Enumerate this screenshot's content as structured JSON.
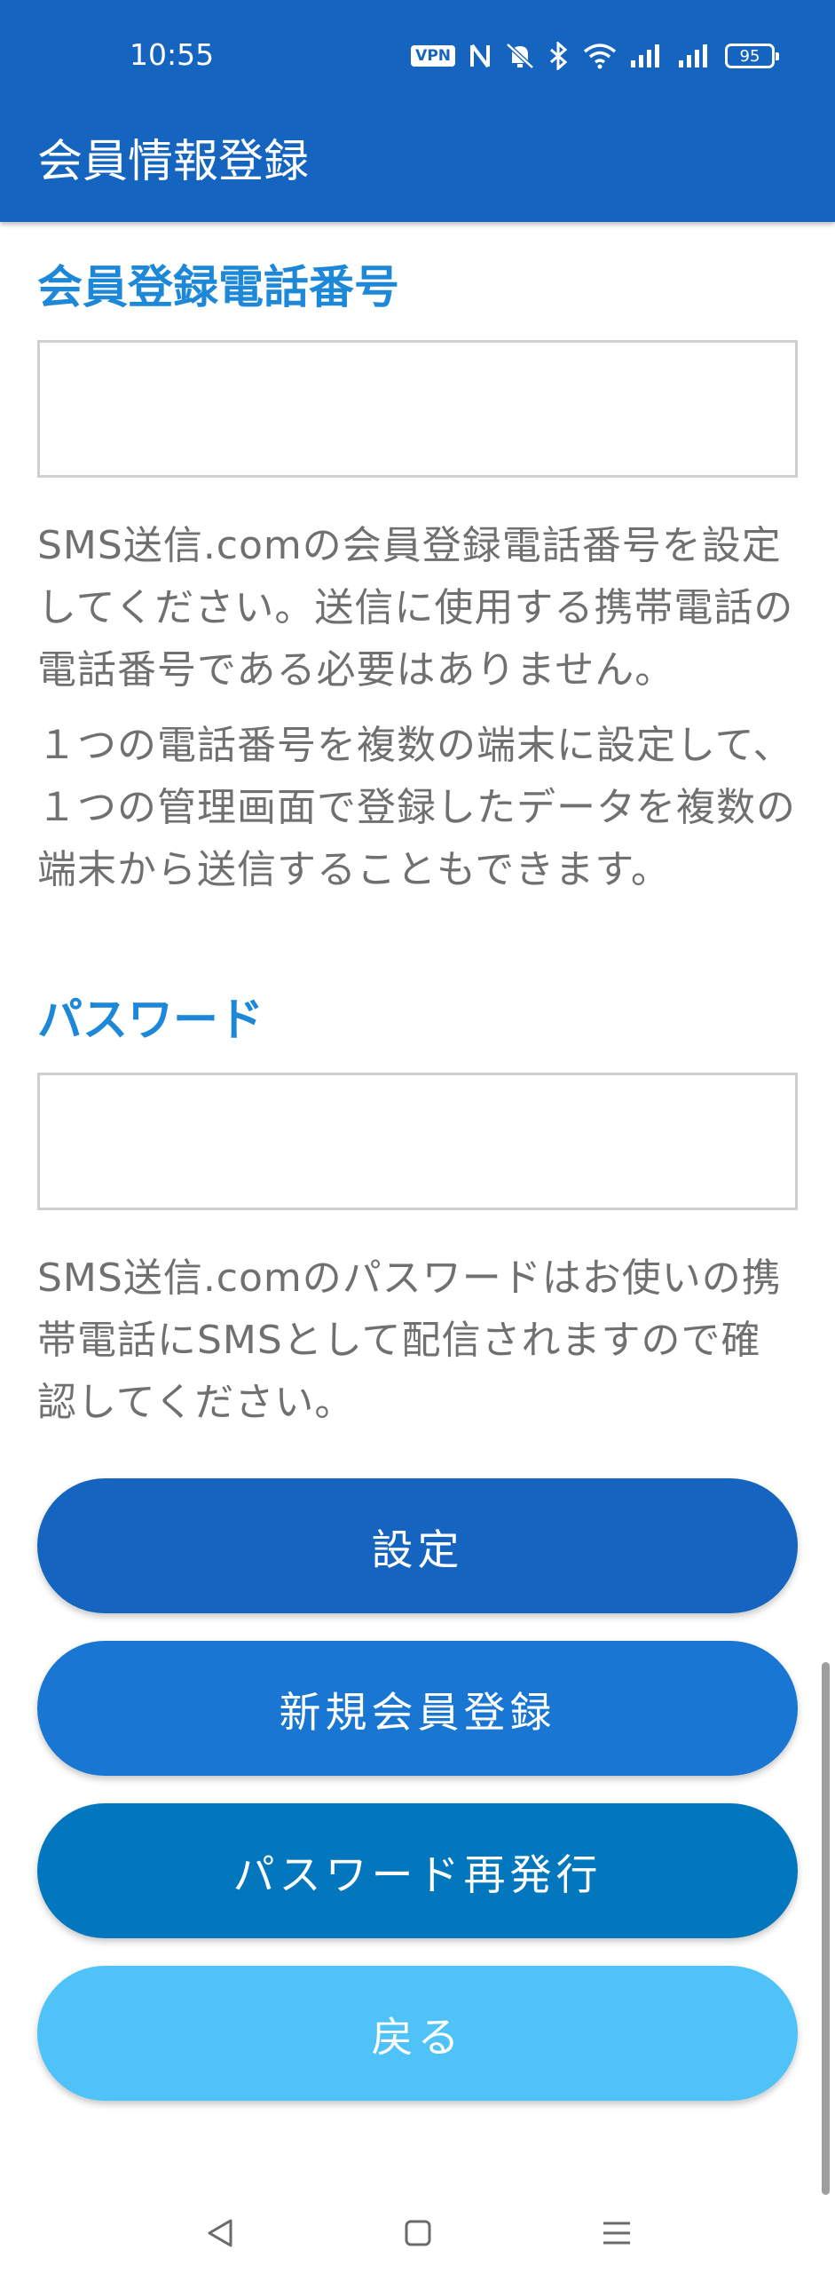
{
  "status_bar": {
    "time": "10:55",
    "vpn": "VPN",
    "battery": "95"
  },
  "app_bar": {
    "title": "会員情報登録"
  },
  "phone_section": {
    "label": "会員登録電話番号",
    "value": "",
    "help_1": "SMS送信.comの会員登録電話番号を設定してください。送信に使用する携帯電話の電話番号である必要はありません。",
    "help_2": "１つの電話番号を複数の端末に設定して、１つの管理画面で登録したデータを複数の端末から送信することもできます。"
  },
  "password_section": {
    "label": "パスワード",
    "value": "",
    "help": "SMS送信.comのパスワードはお使いの携帯電話にSMSとして配信されますので確認してください。"
  },
  "buttons": {
    "settings": "設定",
    "new_member": "新規会員登録",
    "reissue_password": "パスワード再発行",
    "back": "戻る"
  },
  "colors": {
    "primary": "#1565c0",
    "accent_label": "#1e88d8",
    "button_settings": "#1565c0",
    "button_new_member": "#1976d2",
    "button_reissue": "#0277bd",
    "button_back": "#4fc3f7"
  },
  "nav_bar": {
    "back_icon": "triangle-back-icon",
    "home_icon": "square-home-icon",
    "menu_icon": "menu-lines-icon"
  }
}
